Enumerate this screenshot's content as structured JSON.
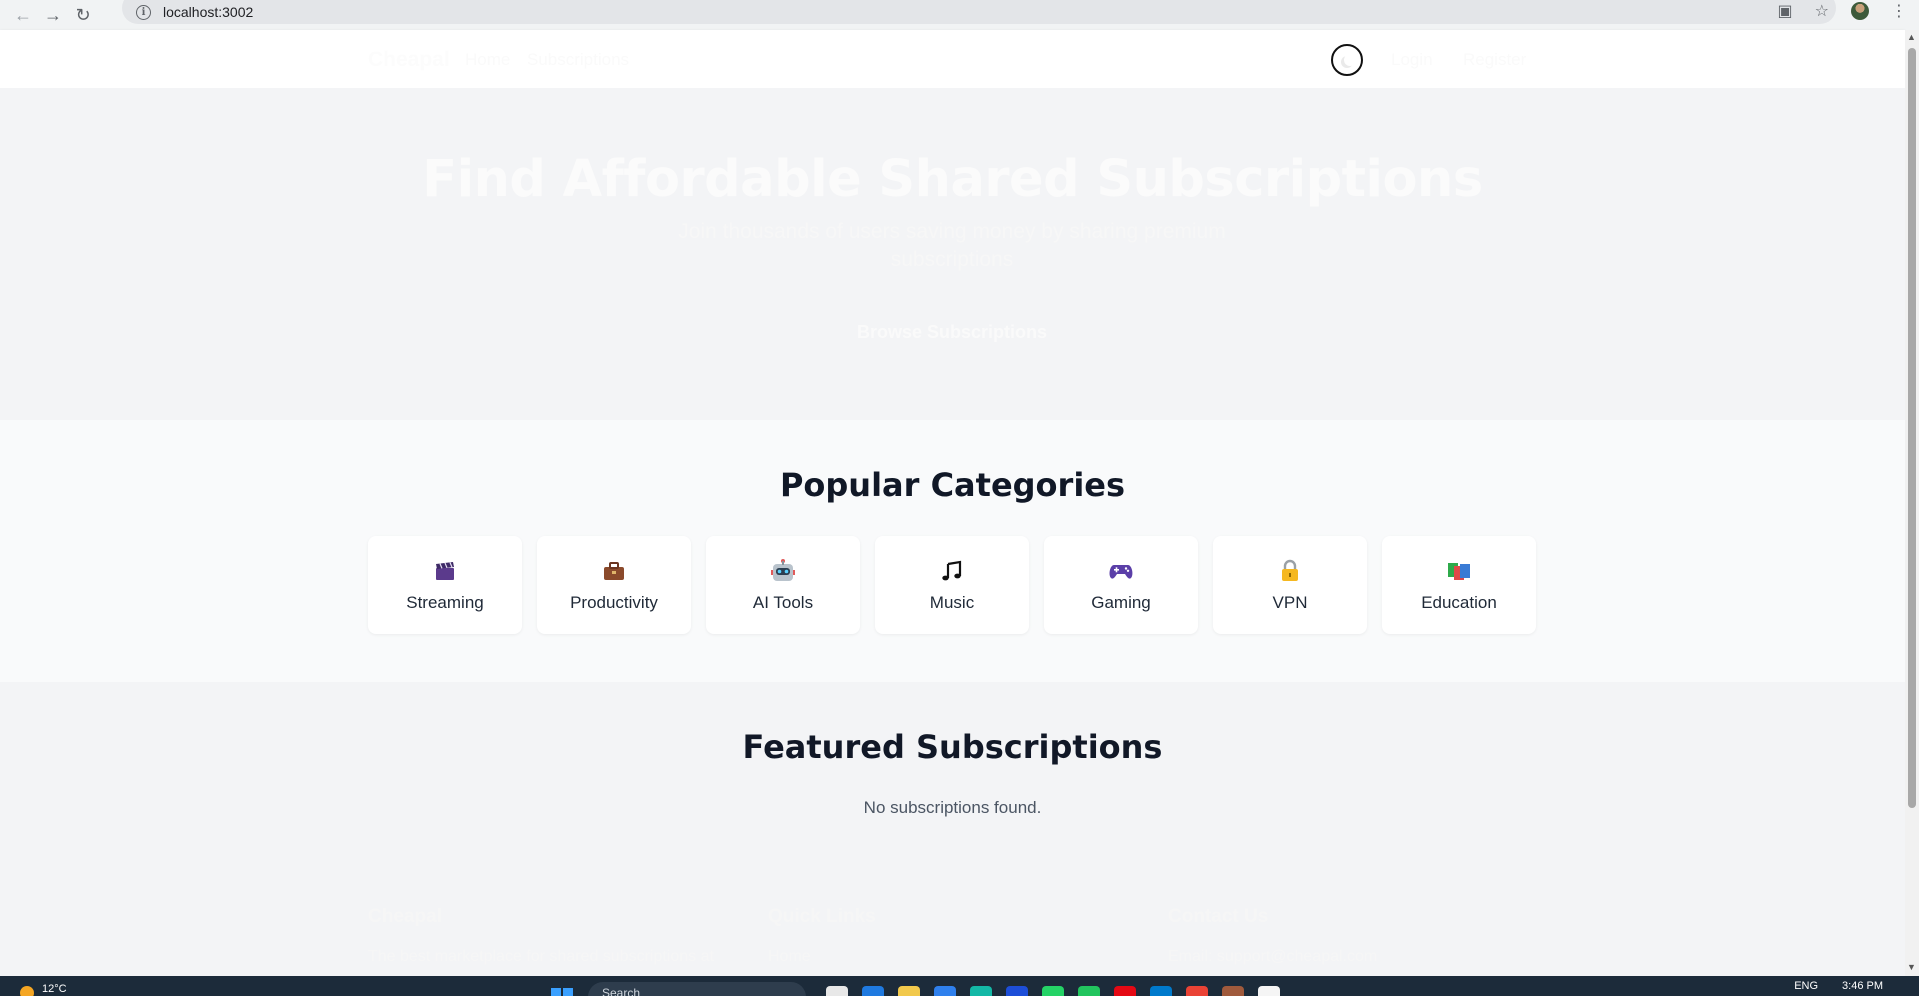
{
  "browser": {
    "url": "localhost:3002",
    "back_icon": "arrow-left-icon",
    "forward_icon": "arrow-right-icon",
    "reload_icon": "reload-icon"
  },
  "header": {
    "brand": "Cheapal",
    "nav": [
      "Home",
      "Subscriptions"
    ],
    "login": "Login",
    "register": "Register",
    "theme_icon": "moon-icon"
  },
  "hero": {
    "title": "Find Affordable Shared Subscriptions",
    "subtitle": "Join thousands of users saving money by sharing premium subscriptions",
    "cta": "Browse Subscriptions"
  },
  "categories": {
    "title": "Popular Categories",
    "items": [
      {
        "label": "Streaming",
        "icon": "clapperboard-icon"
      },
      {
        "label": "Productivity",
        "icon": "briefcase-icon"
      },
      {
        "label": "AI Tools",
        "icon": "robot-icon"
      },
      {
        "label": "Music",
        "icon": "music-note-icon"
      },
      {
        "label": "Gaming",
        "icon": "gamepad-icon"
      },
      {
        "label": "VPN",
        "icon": "lock-icon"
      },
      {
        "label": "Education",
        "icon": "books-icon"
      }
    ]
  },
  "featured": {
    "title": "Featured Subscriptions",
    "empty": "No subscriptions found."
  },
  "footer": {
    "brand": "Cheapal",
    "tagline": "The best marketplace for shared subscriptions at",
    "quick_links_title": "Quick Links",
    "quick_link_home": "Home",
    "contact_title": "Contact Us",
    "contact_email": "Email: support@cheapal.com"
  },
  "taskbar": {
    "temperature": "12°C",
    "search": "Search",
    "language": "ENG",
    "time": "3:46 PM"
  },
  "colors": {
    "heading": "#111827",
    "hero_bg": "#f3f4f6",
    "categories_bg": "#f9fafb"
  }
}
